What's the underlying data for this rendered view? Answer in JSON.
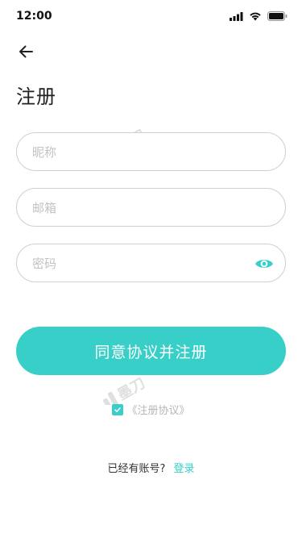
{
  "status_bar": {
    "time": "12:00",
    "icons": [
      "signal-icon",
      "wifi-icon",
      "battery-icon"
    ]
  },
  "header": {
    "back_icon": "arrow-left-icon",
    "title": "注册"
  },
  "form": {
    "nickname": {
      "value": "",
      "placeholder": "昵称"
    },
    "email": {
      "value": "",
      "placeholder": "邮箱"
    },
    "password": {
      "value": "",
      "placeholder": "密码",
      "toggle_icon": "eye-icon"
    }
  },
  "register_button": {
    "label": "同意协议并注册"
  },
  "agreement": {
    "checked": true,
    "label": "《注册协议》"
  },
  "login": {
    "question": "已经有账号?",
    "link": "登录"
  },
  "watermark": {
    "text": "墨刀"
  },
  "colors": {
    "accent": "#38cfc9",
    "border": "#cfcfcf",
    "placeholder": "#c2c2c2"
  }
}
